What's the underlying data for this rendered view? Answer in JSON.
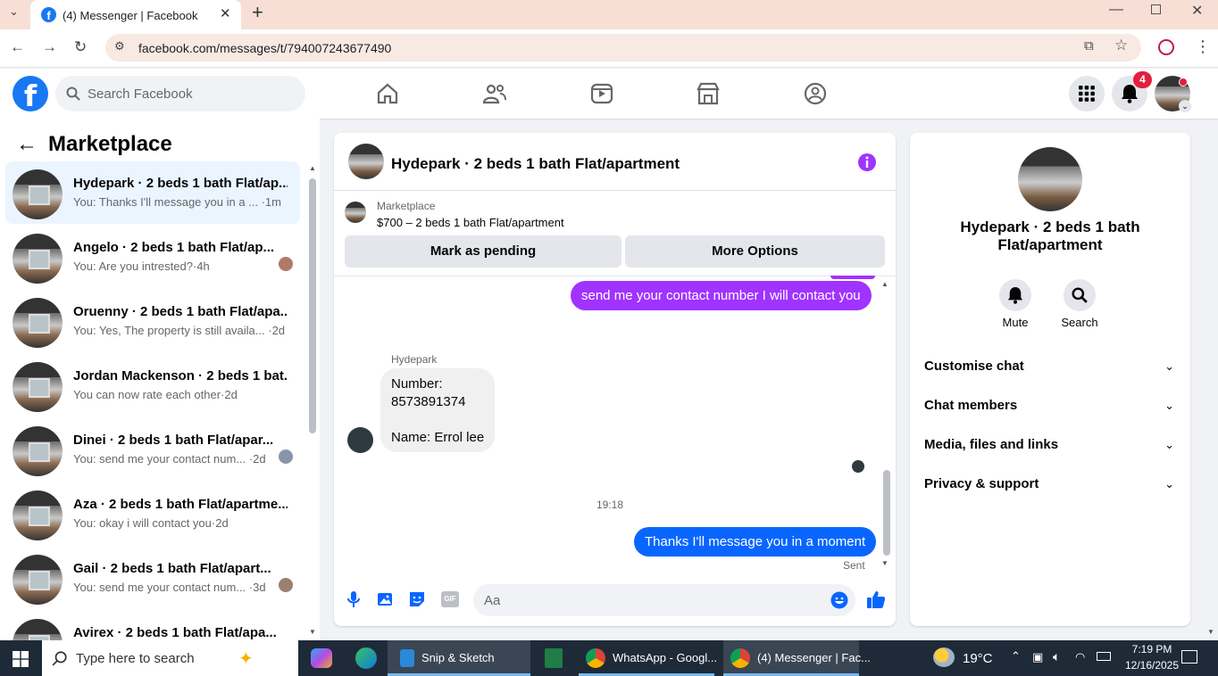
{
  "browser": {
    "tab_title": "(4) Messenger | Facebook",
    "url": "facebook.com/messages/t/794007243677490"
  },
  "header": {
    "search_placeholder": "Search Facebook",
    "notification_count": "4"
  },
  "left": {
    "title": "Marketplace",
    "conversations": [
      {
        "name": "Hydepark · 2 beds 1 bath Flat/ap...",
        "preview": "You: Thanks I'll message you in a ... ·1m"
      },
      {
        "name": "Angelo · 2 beds 1 bath Flat/ap...",
        "preview": "You: Are you intrested?·4h"
      },
      {
        "name": "Oruenny · 2 beds 1 bath Flat/apa...",
        "preview": "You: Yes, The property is still availa... ·2d"
      },
      {
        "name": "Jordan Mackenson · 2 beds 1 bat...",
        "preview": "You can now rate each other·2d"
      },
      {
        "name": "Dinei · 2 beds 1 bath Flat/apar...",
        "preview": "You: send me your contact num... ·2d"
      },
      {
        "name": "Aza · 2 beds 1 bath Flat/apartme...",
        "preview": "You: okay i will contact you·2d"
      },
      {
        "name": "Gail · 2 beds 1 bath Flat/apart...",
        "preview": "You: send me your contact num... ·3d"
      },
      {
        "name": "Avirex · 2 beds 1 bath Flat/apa...",
        "preview": ""
      }
    ]
  },
  "chat": {
    "title": "Hydepark · 2 beds 1 bath Flat/apartment",
    "listing_label": "Marketplace",
    "listing_desc": "$700 – 2 beds 1 bath Flat/apartment",
    "mark_pending": "Mark as pending",
    "more_options": "More Options",
    "msg_out1": "send me your contact number I will contact you",
    "sender_name": "Hydepark",
    "msg_in_line1": "Number:",
    "msg_in_line2": "8573891374",
    "msg_in_line3": "Name: Errol lee",
    "time": "19:18",
    "msg_out2": "Thanks I'll message you in a moment",
    "sent": "Sent",
    "composer_placeholder": "Aa"
  },
  "right": {
    "name": "Hydepark · 2 beds 1 bath Flat/apartment",
    "mute": "Mute",
    "search": "Search",
    "sections": [
      "Customise chat",
      "Chat members",
      "Media, files and links",
      "Privacy & support"
    ]
  },
  "taskbar": {
    "search_text": "Type here to search",
    "app1": "Snip & Sketch",
    "app2": "WhatsApp - Googl...",
    "app3": "(4) Messenger | Fac...",
    "weather": "19°C",
    "time": "7:19 PM",
    "date": "12/16/2025"
  },
  "colors": {
    "fb_blue": "#1877f2",
    "bubble_blue": "#0866ff",
    "bubble_purple": "#a033ff"
  }
}
